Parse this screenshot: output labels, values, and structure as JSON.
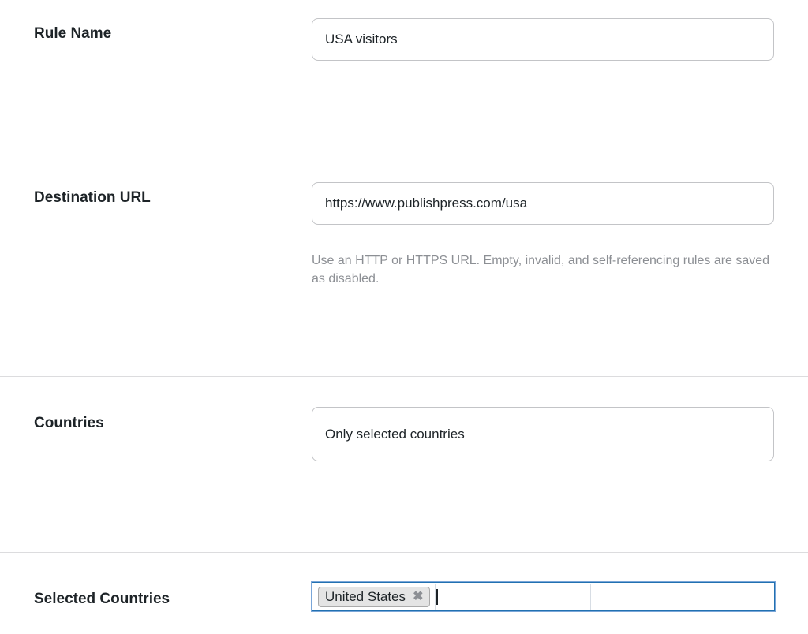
{
  "rule_name": {
    "label": "Rule Name",
    "value": "USA visitors"
  },
  "destination_url": {
    "label": "Destination URL",
    "value": "https://www.publishpress.com/usa",
    "help": "Use an HTTP or HTTPS URL. Empty, invalid, and self-referencing rules are saved as disabled."
  },
  "countries": {
    "label": "Countries",
    "value": "Only selected countries"
  },
  "selected_countries": {
    "label": "Selected Countries",
    "chips": [
      {
        "label": "United States",
        "remove_glyph": "✖"
      }
    ]
  },
  "colors": {
    "focus_border": "#2271b1",
    "chip_background": "#e4e4e4",
    "help_text": "#8c8f94"
  }
}
